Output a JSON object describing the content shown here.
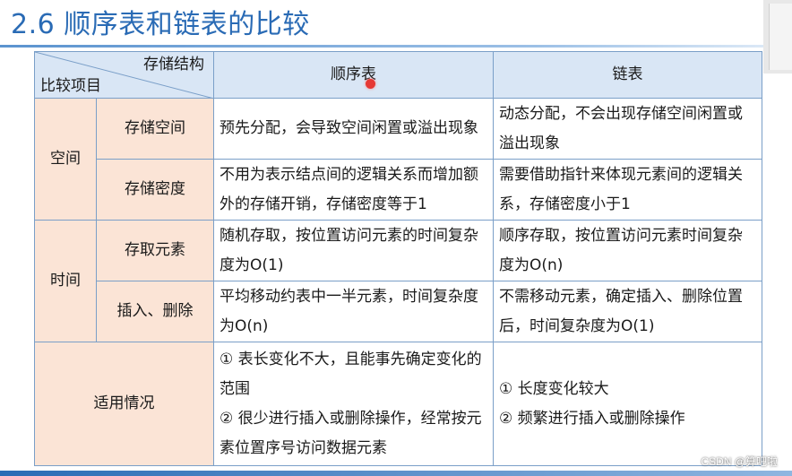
{
  "page": {
    "title": "2.6 顺序表和链表的比较"
  },
  "table": {
    "header_top_right": "存储结构",
    "header_bottom_left": "比较项目",
    "col_seq": "顺序表",
    "col_link": "链表",
    "groups": {
      "space": "空间",
      "time": "时间",
      "usage": "适用情况"
    },
    "rows": [
      {
        "item": "存储空间",
        "seq": "预先分配，会导致空间闲置或溢出现象",
        "link": "动态分配，不会出现存储空间闲置或溢出现象"
      },
      {
        "item": "存储密度",
        "seq": "不用为表示结点间的逻辑关系而增加额外的存储开销，存储密度等于1",
        "link": "需要借助指针来体现元素间的逻辑关系，存储密度小于1"
      },
      {
        "item": "存取元素",
        "seq": "随机存取，按位置访问元素的时间复杂度为O(1)",
        "link": "顺序存取，按位置访问元素时间复杂度为O(n)"
      },
      {
        "item": "插入、删除",
        "seq": "平均移动约表中一半元素，时间复杂度为O(n)",
        "link": "不需移动元素，确定插入、删除位置后，时间复杂度为O(1)"
      }
    ],
    "usage": {
      "seq_1": "① 表长变化不大，且能事先确定变化的范围",
      "seq_2": "② 很少进行插入或删除操作，经常按元素位置序号访问数据元素",
      "link_1": "① 长度变化较大",
      "link_2": "② 频繁进行插入或删除操作"
    }
  },
  "watermark": "CSDN @算吧啦",
  "colors": {
    "title": "#2a6bb5",
    "header_bg": "#d9e6f5",
    "group_bg": "#fbe4d6",
    "border": "#7a9fc8"
  }
}
